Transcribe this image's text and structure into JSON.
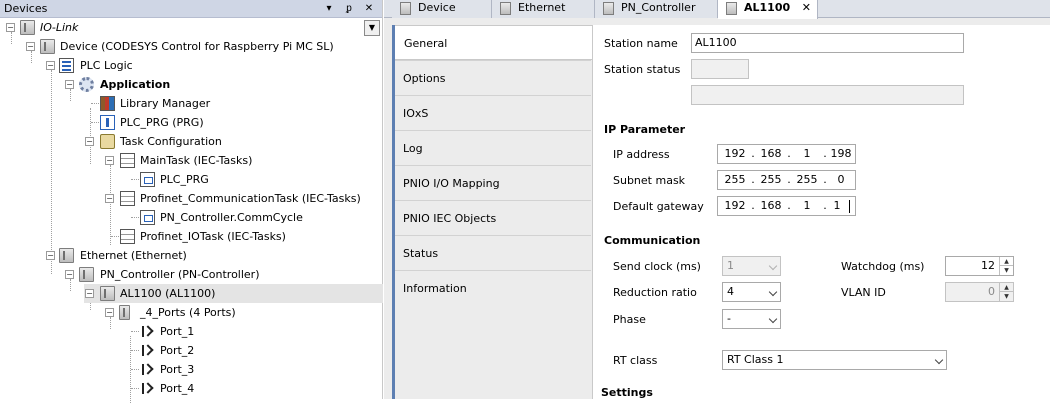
{
  "devices_panel": {
    "title": "Devices",
    "controls": {
      "dropdown": "▾",
      "pin": "ᵱ",
      "close": "✕"
    },
    "root_label": "IO-Link",
    "tree": [
      {
        "label": "Device (CODESYS Control for Raspberry Pi MC SL)",
        "icon": "device-icon"
      },
      {
        "label": "PLC Logic",
        "icon": "plc-logic-icon"
      },
      {
        "label": "Application",
        "icon": "application-gear-icon"
      },
      {
        "label": "Library Manager",
        "icon": "library-manager-icon"
      },
      {
        "label": "PLC_PRG (PRG)",
        "icon": "program-icon"
      },
      {
        "label": "Task Configuration",
        "icon": "task-configuration-icon"
      },
      {
        "label": "MainTask (IEC-Tasks)",
        "icon": "task-icon"
      },
      {
        "label": "PLC_PRG",
        "icon": "program-call-icon"
      },
      {
        "label": "Profinet_CommunicationTask (IEC-Tasks)",
        "icon": "task-icon"
      },
      {
        "label": "PN_Controller.CommCycle",
        "icon": "program-call-icon"
      },
      {
        "label": "Profinet_IOTask (IEC-Tasks)",
        "icon": "task-icon"
      },
      {
        "label": "Ethernet (Ethernet)",
        "icon": "ethernet-device-icon"
      },
      {
        "label": "PN_Controller (PN-Controller)",
        "icon": "controller-device-icon"
      },
      {
        "label": "AL1100 (AL1100)",
        "icon": "al1100-device-icon"
      },
      {
        "label": "_4_Ports (4 Ports)",
        "icon": "ports-module-icon"
      },
      {
        "label": "Port_1",
        "icon": "port-icon"
      },
      {
        "label": "Port_2",
        "icon": "port-icon"
      },
      {
        "label": "Port_3",
        "icon": "port-icon"
      },
      {
        "label": "Port_4",
        "icon": "port-icon"
      }
    ]
  },
  "doc_tabs": [
    {
      "label": "Device"
    },
    {
      "label": "Ethernet"
    },
    {
      "label": "PN_Controller"
    },
    {
      "label": "AL1100",
      "close": "✕"
    }
  ],
  "editor_tabs": [
    {
      "label": "General"
    },
    {
      "label": "Options"
    },
    {
      "label": "IOxS"
    },
    {
      "label": "Log"
    },
    {
      "label": "PNIO I/O Mapping"
    },
    {
      "label": "PNIO IEC Objects"
    },
    {
      "label": "Status"
    },
    {
      "label": "Information"
    }
  ],
  "general": {
    "station_name": {
      "label": "Station name",
      "value": "AL1100"
    },
    "station_status": {
      "label": "Station status"
    },
    "ip_section": "IP Parameter",
    "ip_address": {
      "label": "IP address",
      "parts": [
        "192",
        "168",
        "1",
        "198"
      ]
    },
    "subnet_mask": {
      "label": "Subnet mask",
      "parts": [
        "255",
        "255",
        "255",
        "0"
      ]
    },
    "default_gateway": {
      "label": "Default gateway",
      "parts": [
        "192",
        "168",
        "1",
        "1"
      ]
    },
    "ip_separator": ".",
    "comm_section": "Communication",
    "send_clock": {
      "label": "Send clock (ms)",
      "value": "1"
    },
    "reduction_ratio": {
      "label": "Reduction ratio",
      "value": "4"
    },
    "phase": {
      "label": "Phase",
      "value": "-"
    },
    "watchdog": {
      "label": "Watchdog (ms)",
      "value": "12"
    },
    "vlan_id": {
      "label": "VLAN ID",
      "value": "0"
    },
    "rt_class": {
      "label": "RT class",
      "value": "RT Class 1"
    },
    "settings_section": "Settings"
  },
  "spin_arrows": {
    "up": "▲",
    "down": "▼"
  }
}
